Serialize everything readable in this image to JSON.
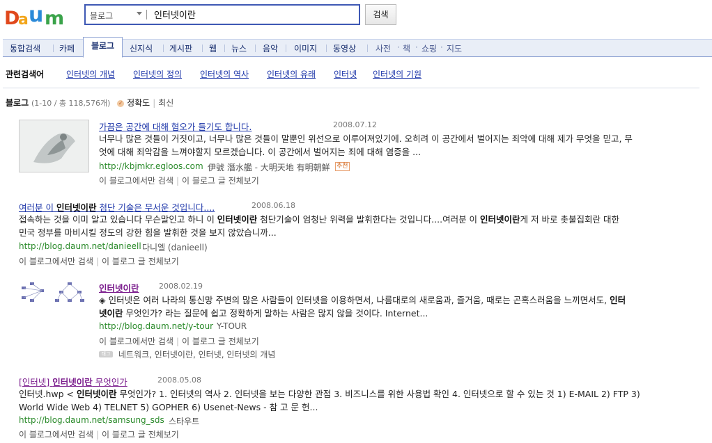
{
  "header": {
    "logo_text": "Daum",
    "search_category": "블로그",
    "query": "인터넷이란",
    "search_button": "검색"
  },
  "tabs": {
    "items": [
      "통합검색",
      "카페",
      "블로그",
      "신지식",
      "게시판",
      "웹",
      "뉴스",
      "음악",
      "이미지",
      "동영상"
    ],
    "active": "블로그",
    "extra": [
      "사전",
      "책",
      "쇼핑",
      "지도"
    ]
  },
  "related": {
    "title": "관련검색어",
    "links": [
      "인터넷의 개념",
      "인터넷의 정의",
      "인터넷의 역사",
      "인터넷의 유래",
      "인터넷",
      "인터넷의 기원"
    ]
  },
  "section": {
    "title": "블로그",
    "count": "(1-10 / 총 118,576개)",
    "sort_accuracy": "정확도",
    "sort_recent": "최신"
  },
  "results": [
    {
      "title_pre": "가끔은 ",
      "title_bold": "",
      "title_post": "공간에 대해 혐오가 들기도 합니다.",
      "date": "2008.07.12",
      "body_1": "너무나 많은 것들이 거짓이고, 너무나 많은 것들이 말뿐인 위선으로 이루어져있기에. 오히려 이 공간에서 벌어지는 죄악에 대해 제가 무엇을 믿고, 무",
      "body_2": "엇에 대해 죄악감을 느껴야할지 모르겠습니다. 이 공간에서 벌어지는 죄에 대해 염증을 ...",
      "url": "http://kbjmkr.egloos.com",
      "author": "伊號 潛水艦 - 大明天地 有明朝鮮",
      "badge": "추천",
      "link_1": "이 블로그에서만 검색",
      "link_2": "이 블로그 글 전체보기"
    },
    {
      "title_pre": "여러분 이 ",
      "title_bold": "인터넷이란",
      "title_post": " 첨단 기술은 무서운 것입니다....",
      "date": "2008.06.18",
      "body_1a": "접속하는 것을 이미 알고 있습니다 무슨말인고 하니 이 ",
      "body_1b": "인터넷이란",
      "body_1c": " 첨단기술이 엄청난 위력을 발휘한다는 것입니다....여러분 이 ",
      "body_1d": "인터넷이란",
      "body_1e": "게 저 바로 촛불집회란 대한",
      "body_2": "민국 정부를 마비시킬 정도의 강한 힘을 발휘한 것을 보지 않았습니까...",
      "url": "http://blog.daum.net/danieell",
      "author": "다니엘 (danieell)",
      "link_1": "이 블로그에서만 검색",
      "link_2": "이 블로그 글 전체보기"
    },
    {
      "title_bold": "인터넷이란",
      "date": "2008.02.19",
      "body_1a": "◈ 인터넷은 여러 나라의 통신망 주변의 많은 사람들이 인터넷을 이용하면서, 나름대로의 새로움과, 즐거움, 때로는 곤혹스러움을 느끼면서도, ",
      "body_1b": "인터",
      "body_2a": "넷이란",
      "body_2b": " 무엇인가? 라는 질문에 쉽고 정확하게 말하는 사람은 많지 않을 것이다. Internet...",
      "url": "http://blog.daum.net/y-tour",
      "author": "Y-TOUR",
      "link_1": "이 블로그에서만 검색",
      "link_2": "이 블로그 글 전체보기",
      "tag_label": "태그",
      "tags": "네트워크, 인터넷이란, 인터넷, 인터넷의 개념"
    },
    {
      "title_pre": "[인터넷] ",
      "title_bold": "인터넷이란",
      "title_post": " 무엇인가",
      "date": "2008.05.08",
      "body_1a": "인터넷.hwp < ",
      "body_1b": "인터넷이란",
      "body_1c": " 무엇인가? 1. 인터넷의 역사 2. 인터넷을 보는 다양한 관점 3. 비즈니스를 위한 사용법 확인 4. 인터넷으로 할 수 있는 것 1) E-MAIL 2) FTP 3)",
      "body_2": "World Wide Web 4) TELNET 5) GOPHER 6) Usenet-News - 참 고 문 헌...",
      "url": "http://blog.daum.net/samsung_sds",
      "author": "스타우트",
      "link_1": "이 블로그에서만 검색",
      "link_2": "이 블로그 글 전체보기"
    }
  ]
}
